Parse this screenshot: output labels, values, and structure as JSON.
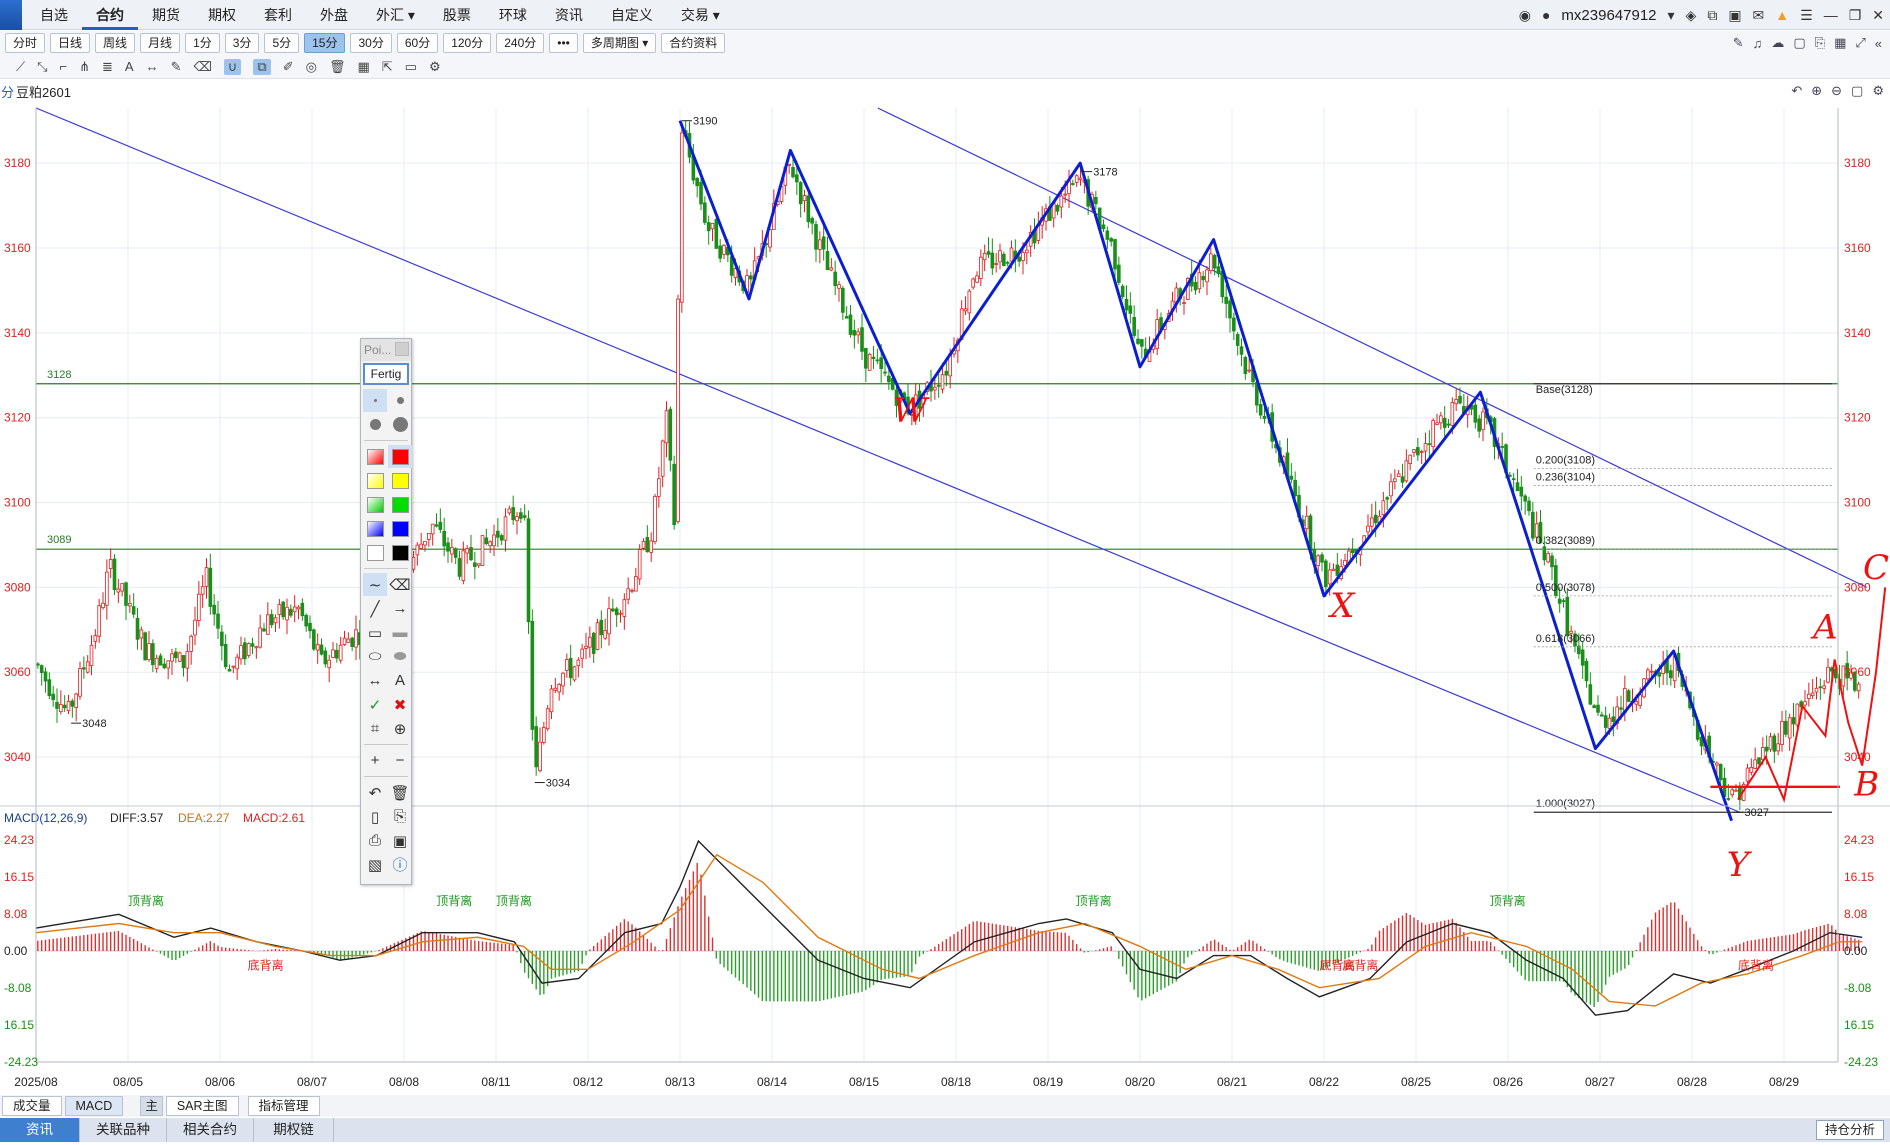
{
  "menubar": {
    "items": [
      "自选",
      "合约",
      "期货",
      "期权",
      "套利",
      "外盘",
      "外汇 ▾",
      "股票",
      "环球",
      "资讯",
      "自定义",
      "交易 ▾"
    ],
    "active_index": 1,
    "username": "mx239647912",
    "right_icons": [
      "eye-icon",
      "level2-icon",
      "layers-icon",
      "link-icon",
      "mail-icon",
      "bell-icon",
      "list-icon",
      "minimize-icon",
      "restore-icon",
      "close-icon"
    ]
  },
  "period_bar": {
    "buttons": [
      "分时",
      "日线",
      "周线",
      "月线",
      "1分",
      "3分",
      "5分",
      "15分",
      "30分",
      "60分",
      "120分",
      "240分",
      "•••",
      "多周期图 ▾",
      "合约资料"
    ],
    "active": "15分"
  },
  "chart_header": {
    "prefix": "分",
    "symbol": "豆粕2601"
  },
  "colors": {
    "up": "#e02020",
    "down": "#1a8f1a",
    "wave": "#0b1fd0",
    "channel": "#3a3ad8",
    "hline": "#2a7a2a",
    "hand": "#ee1111",
    "diff": "#222222",
    "dea": "#e07a10",
    "macd_up": "#dd3030",
    "macd_dn": "#2aa02a",
    "axis_text_red": "#e02020"
  },
  "float_toolbar": {
    "title": "Poi...",
    "done_label": "Fertig"
  },
  "bottom_tabs": [
    "成交量",
    "MACD",
    "主",
    "SAR主图",
    "指标管理"
  ],
  "nav_tabs": [
    "资讯",
    "关联品种",
    "相关合约",
    "期权链"
  ],
  "holdings_label": "持仓分析",
  "chart_data": {
    "type": "candlestick",
    "symbol": "豆粕2601",
    "period": "15分",
    "x_tick_labels": [
      "2025/08",
      "08/05",
      "08/06",
      "08/07",
      "08/08",
      "08/11",
      "08/12",
      "08/13",
      "08/14",
      "08/15",
      "08/18",
      "08/19",
      "08/20",
      "08/21",
      "08/22",
      "08/25",
      "08/26",
      "08/27",
      "08/28",
      "08/29"
    ],
    "y_ticks": [
      3040,
      3060,
      3080,
      3100,
      3120,
      3140,
      3160,
      3180
    ],
    "ylim": [
      3028,
      3193
    ],
    "high_low_labels": [
      {
        "text": "3190",
        "x": 7.0,
        "y": 3190
      },
      {
        "text": "3178",
        "x": 11.35,
        "y": 3178
      },
      {
        "text": "3048",
        "x": 0.36,
        "y": 3048
      },
      {
        "text": "3034",
        "x": 5.4,
        "y": 3034
      },
      {
        "text": "3027",
        "x": 18.43,
        "y": 3027
      }
    ],
    "horizontal_lines": [
      {
        "label": "3128",
        "value": 3128
      },
      {
        "label": "3089",
        "value": 3089
      }
    ],
    "fib_levels": [
      {
        "label": "Base(3128)",
        "value": 3128
      },
      {
        "label": "0.200(3108)",
        "value": 3108
      },
      {
        "label": "0.236(3104)",
        "value": 3104
      },
      {
        "label": "0.382(3089)",
        "value": 3089
      },
      {
        "label": "0.500(3078)",
        "value": 3078
      },
      {
        "label": "0.618(3066)",
        "value": 3066
      },
      {
        "label": "1.000(3027)",
        "value": 3027
      }
    ],
    "channel_lines": [
      {
        "from": [
          0,
          3193
        ],
        "to": [
          18.52,
          3027
        ]
      },
      {
        "from": [
          9.15,
          3193
        ],
        "to": [
          19.9,
          3080
        ]
      }
    ],
    "wave_path": [
      [
        7.0,
        3190
      ],
      [
        7.75,
        3148
      ],
      [
        8.2,
        3183
      ],
      [
        9.5,
        3121
      ],
      [
        11.35,
        3180
      ],
      [
        12.0,
        3132
      ],
      [
        12.8,
        3162
      ],
      [
        14.0,
        3078
      ],
      [
        15.7,
        3126
      ],
      [
        16.95,
        3042
      ],
      [
        17.8,
        3065
      ],
      [
        18.43,
        3025
      ]
    ],
    "wave_labels": [
      {
        "text": "W",
        "x": 9.5,
        "y": 3119
      },
      {
        "text": "X",
        "x": 14.2,
        "y": 3073
      },
      {
        "text": "Y",
        "x": 18.5,
        "y": 3012
      },
      {
        "text": "A",
        "x": 19.45,
        "y": 3068
      },
      {
        "text": "B",
        "x": 19.9,
        "y": 3031
      },
      {
        "text": "C",
        "x": 20.0,
        "y": 3082
      }
    ],
    "series_ohlc_path": [
      [
        0,
        3062
      ],
      [
        0.35,
        3050
      ],
      [
        0.65,
        3070
      ],
      [
        0.8,
        3085
      ],
      [
        1.2,
        3065
      ],
      [
        1.6,
        3062
      ],
      [
        1.85,
        3082
      ],
      [
        2.1,
        3060
      ],
      [
        2.5,
        3072
      ],
      [
        2.85,
        3075
      ],
      [
        3.1,
        3062
      ],
      [
        3.4,
        3068
      ],
      [
        3.8,
        3073
      ],
      [
        4.0,
        3083
      ],
      [
        4.3,
        3095
      ],
      [
        4.6,
        3085
      ],
      [
        4.9,
        3090
      ],
      [
        5.3,
        3100
      ],
      [
        5.42,
        3034
      ],
      [
        5.6,
        3058
      ],
      [
        5.9,
        3062
      ],
      [
        6.2,
        3072
      ],
      [
        6.45,
        3080
      ],
      [
        6.7,
        3094
      ],
      [
        6.85,
        3120
      ],
      [
        6.95,
        3092
      ],
      [
        7.0,
        3190
      ],
      [
        7.3,
        3165
      ],
      [
        7.75,
        3150
      ],
      [
        8.2,
        3180
      ],
      [
        8.6,
        3155
      ],
      [
        9.0,
        3135
      ],
      [
        9.5,
        3122
      ],
      [
        9.9,
        3132
      ],
      [
        10.2,
        3155
      ],
      [
        10.7,
        3160
      ],
      [
        11.0,
        3168
      ],
      [
        11.35,
        3176
      ],
      [
        11.7,
        3160
      ],
      [
        12.0,
        3134
      ],
      [
        12.4,
        3148
      ],
      [
        12.8,
        3158
      ],
      [
        13.1,
        3135
      ],
      [
        13.5,
        3112
      ],
      [
        13.8,
        3095
      ],
      [
        14.0,
        3082
      ],
      [
        14.4,
        3092
      ],
      [
        14.8,
        3105
      ],
      [
        15.2,
        3118
      ],
      [
        15.5,
        3124
      ],
      [
        15.8,
        3117
      ],
      [
        16.2,
        3098
      ],
      [
        16.5,
        3082
      ],
      [
        16.8,
        3060
      ],
      [
        17.0,
        3048
      ],
      [
        17.4,
        3056
      ],
      [
        17.8,
        3062
      ],
      [
        18.1,
        3045
      ],
      [
        18.43,
        3030
      ],
      [
        18.8,
        3042
      ],
      [
        19.2,
        3052
      ],
      [
        19.5,
        3060
      ],
      [
        19.8,
        3057
      ]
    ],
    "macd": {
      "label": "MACD(12,26,9)",
      "values_text": {
        "diff": "DIFF:3.57",
        "dea": "DEA:2.27",
        "macd": "MACD:2.61"
      },
      "y_ticks": [
        "24.23",
        "16.15",
        "8.08",
        "0.00",
        "-8.08",
        "16.15",
        "-24.23"
      ],
      "y_tick_values": [
        24.23,
        16.15,
        8.08,
        0,
        -8.08,
        -16.15,
        -24.23
      ],
      "ylim": [
        -24.23,
        24.23
      ],
      "diff_path": [
        [
          0,
          5
        ],
        [
          0.9,
          8
        ],
        [
          1.5,
          3
        ],
        [
          1.9,
          5
        ],
        [
          2.4,
          2
        ],
        [
          2.9,
          0
        ],
        [
          3.3,
          -2
        ],
        [
          3.7,
          -1
        ],
        [
          4.2,
          4
        ],
        [
          4.8,
          4
        ],
        [
          5.2,
          2
        ],
        [
          5.5,
          -7
        ],
        [
          5.9,
          -6
        ],
        [
          6.4,
          4
        ],
        [
          6.8,
          6
        ],
        [
          7.0,
          14
        ],
        [
          7.2,
          24
        ],
        [
          7.5,
          18
        ],
        [
          8.1,
          6
        ],
        [
          8.5,
          -2
        ],
        [
          9.0,
          -6
        ],
        [
          9.5,
          -8
        ],
        [
          10.2,
          2
        ],
        [
          10.9,
          6
        ],
        [
          11.2,
          7
        ],
        [
          11.7,
          4
        ],
        [
          12.0,
          -4
        ],
        [
          12.4,
          -6
        ],
        [
          12.8,
          -1
        ],
        [
          13.2,
          -1
        ],
        [
          13.6,
          -6
        ],
        [
          13.95,
          -10
        ],
        [
          14.5,
          -6
        ],
        [
          14.9,
          2
        ],
        [
          15.4,
          6
        ],
        [
          15.8,
          4
        ],
        [
          16.2,
          -2
        ],
        [
          16.6,
          -6
        ],
        [
          16.95,
          -14
        ],
        [
          17.3,
          -13
        ],
        [
          17.8,
          -5
        ],
        [
          18.2,
          -7
        ],
        [
          18.6,
          -4
        ],
        [
          19.1,
          0
        ],
        [
          19.5,
          4
        ],
        [
          19.85,
          3
        ]
      ],
      "dea_path": [
        [
          0,
          4
        ],
        [
          0.9,
          6
        ],
        [
          1.5,
          4
        ],
        [
          2.0,
          4
        ],
        [
          2.6,
          1
        ],
        [
          3.2,
          -1
        ],
        [
          3.7,
          -1
        ],
        [
          4.2,
          2
        ],
        [
          4.8,
          3
        ],
        [
          5.3,
          1
        ],
        [
          5.6,
          -4
        ],
        [
          6.0,
          -4
        ],
        [
          6.5,
          2
        ],
        [
          7.0,
          9
        ],
        [
          7.4,
          21
        ],
        [
          7.9,
          15
        ],
        [
          8.5,
          3
        ],
        [
          9.2,
          -4
        ],
        [
          9.6,
          -6
        ],
        [
          10.2,
          -1
        ],
        [
          10.9,
          4
        ],
        [
          11.4,
          6
        ],
        [
          12.0,
          1
        ],
        [
          12.5,
          -4
        ],
        [
          13.0,
          -1
        ],
        [
          13.5,
          -4
        ],
        [
          13.95,
          -8
        ],
        [
          14.6,
          -6
        ],
        [
          15.1,
          1
        ],
        [
          15.6,
          4
        ],
        [
          16.2,
          1
        ],
        [
          16.7,
          -4
        ],
        [
          17.1,
          -11
        ],
        [
          17.6,
          -12
        ],
        [
          18.1,
          -7
        ],
        [
          18.6,
          -5
        ],
        [
          19.2,
          -1
        ],
        [
          19.6,
          2
        ],
        [
          19.85,
          2
        ]
      ],
      "divergence_labels": [
        {
          "text": "顶背离",
          "kind": "top",
          "x": 1.0
        },
        {
          "text": "底背离",
          "kind": "bottom",
          "x": 2.3
        },
        {
          "text": "顶背离",
          "kind": "top",
          "x": 4.35
        },
        {
          "text": "顶背离",
          "kind": "top",
          "x": 5.0
        },
        {
          "text": "顶背离",
          "kind": "top",
          "x": 11.3
        },
        {
          "text": "底背离",
          "kind": "bottom",
          "x": 13.95
        },
        {
          "text": "底背离",
          "kind": "bottom",
          "x": 14.2
        },
        {
          "text": "顶背离",
          "kind": "top",
          "x": 15.8
        },
        {
          "text": "底背离",
          "kind": "bottom",
          "x": 18.5
        }
      ]
    }
  }
}
